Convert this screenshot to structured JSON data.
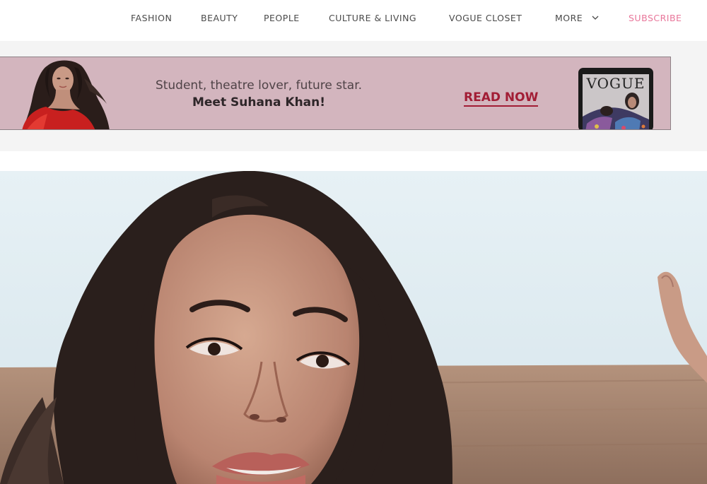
{
  "nav": {
    "items": [
      "FASHION",
      "BEAUTY",
      "PEOPLE",
      "CULTURE & LIVING",
      "VOGUE CLOSET"
    ],
    "more_label": "MORE",
    "more_icon": "chevron-down-icon",
    "subscribe_label": "SUBSCRIBE"
  },
  "banner": {
    "line1": "Student, theatre lover, future star.",
    "line2": "Meet Suhana Khan!",
    "cta": "READ NOW",
    "magazine_title": "VOGUE"
  },
  "colors": {
    "banner_bg": "#d3b5be",
    "cta": "#a21d35",
    "subscribe": "#e8769a",
    "nav_text": "#4a4a4a"
  }
}
